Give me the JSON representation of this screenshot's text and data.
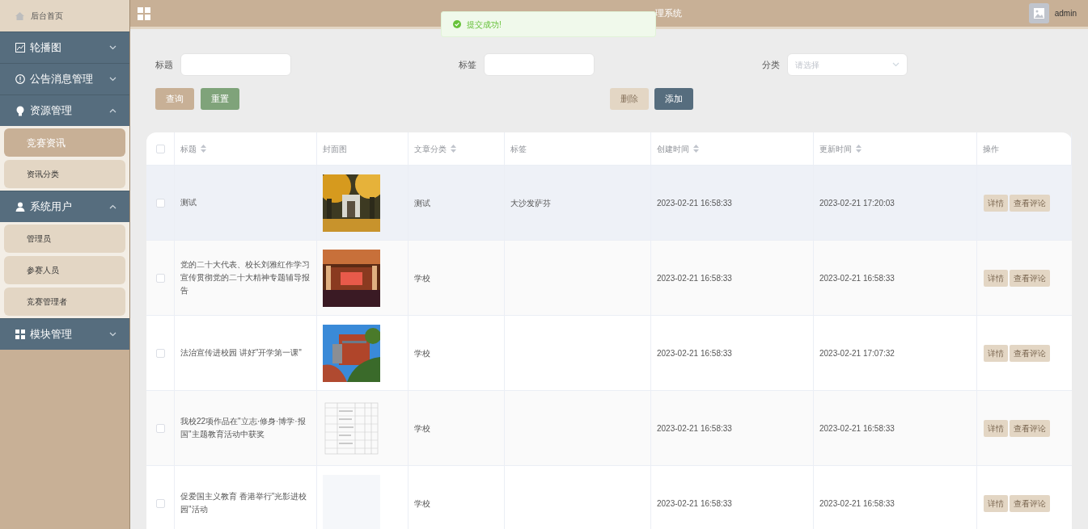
{
  "sidebar": {
    "home": {
      "label": "后台首页"
    },
    "menus": [
      {
        "label": "轮播图",
        "expanded": false
      },
      {
        "label": "公告消息管理",
        "expanded": false
      },
      {
        "label": "资源管理",
        "expanded": true,
        "children": [
          {
            "label": "竞赛资讯",
            "selected": true
          },
          {
            "label": "资讯分类",
            "selected": false
          }
        ]
      },
      {
        "label": "系统用户",
        "expanded": true,
        "children": [
          {
            "label": "管理员",
            "selected": false
          },
          {
            "label": "参赛人员",
            "selected": false
          },
          {
            "label": "竞赛管理者",
            "selected": false
          }
        ]
      },
      {
        "label": "模块管理",
        "expanded": false
      }
    ]
  },
  "header": {
    "title": "理系统",
    "user": "admin"
  },
  "toast": {
    "kind": "success",
    "text": "提交成功!"
  },
  "filters": [
    {
      "label": "标题",
      "kind": "input"
    },
    {
      "label": "标签",
      "kind": "input"
    },
    {
      "label": "分类",
      "kind": "select",
      "placeholder": "请选择"
    }
  ],
  "buttons_left": [
    {
      "label": "查询",
      "disabled": false
    },
    {
      "label": "重置",
      "disabled": false
    }
  ],
  "buttons_right": [
    {
      "label": "删除",
      "disabled": true
    },
    {
      "label": "添加",
      "disabled": false
    }
  ],
  "table": {
    "select_all": {
      "checked": false
    },
    "columns": [
      {
        "label": "标题",
        "sortable": true
      },
      {
        "label": "封面图",
        "sortable": false
      },
      {
        "label": "文章分类",
        "sortable": true
      },
      {
        "label": "标签",
        "sortable": false
      },
      {
        "label": "创建时间",
        "sortable": true
      },
      {
        "label": "更新时间",
        "sortable": true
      },
      {
        "label": "操作",
        "sortable": false
      }
    ],
    "rows": [
      {
        "title": "测试",
        "cover": {
          "kind": "picture"
        },
        "category": "测试",
        "tag": "大沙发萨芬",
        "created": "2023-02-21 16:58:33",
        "updated": "2023-02-21 17:20:03",
        "actions": [
          "详情",
          "查看评论"
        ],
        "checked": false,
        "highlighted": true
      },
      {
        "title": "党的二十大代表、校长刘雅红作学习宣传贯彻党的二十大精神专题辅导报告",
        "cover": {
          "kind": "picture"
        },
        "category": "学校",
        "created": "2023-02-21 16:58:33",
        "updated": "2023-02-21 16:58:33",
        "actions": [
          "详情",
          "查看评论"
        ],
        "checked": false,
        "highlighted": false
      },
      {
        "title": "法治宣传进校园 讲好\"开学第一课\"",
        "cover": {
          "kind": "picture"
        },
        "category": "学校",
        "created": "2023-02-21 16:58:33",
        "updated": "2023-02-21 17:07:32",
        "actions": [
          "详情",
          "查看评论"
        ],
        "checked": false,
        "highlighted": false
      },
      {
        "title": "我校22项作品在\"立志·修身·博学·报国\"主题教育活动中获奖",
        "cover": {
          "kind": "picture"
        },
        "category": "学校",
        "created": "2023-02-21 16:58:33",
        "updated": "2023-02-21 16:58:33",
        "actions": [
          "详情",
          "查看评论"
        ],
        "checked": false,
        "highlighted": false
      },
      {
        "title": "促爱国主义教育 香港举行\"光影进校园\"活动",
        "cover": {
          "kind": "placeholder"
        },
        "category": "学校",
        "created": "2023-02-21 16:58:33",
        "updated": "2023-02-21 16:58:33",
        "actions": [
          "详情",
          "查看评论"
        ],
        "checked": false,
        "highlighted": false
      }
    ]
  }
}
